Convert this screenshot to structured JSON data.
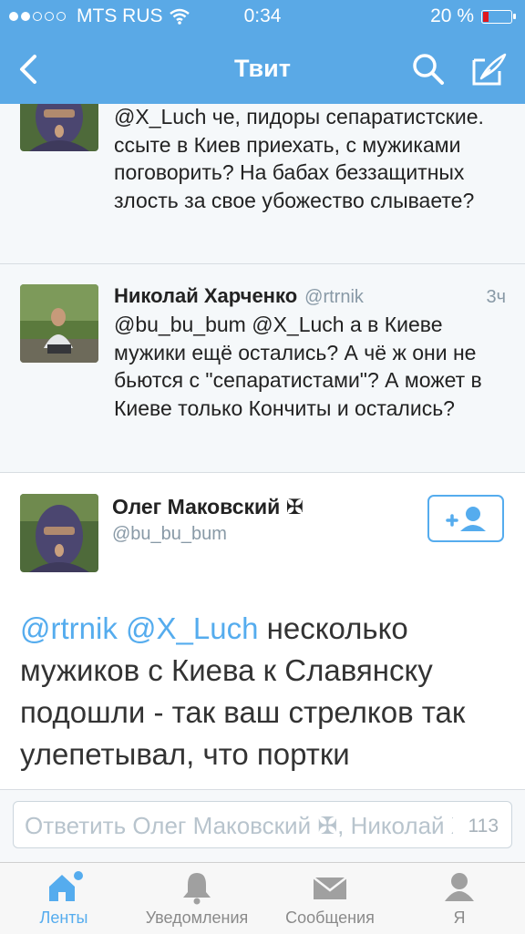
{
  "status_bar": {
    "carrier": "MTS RUS",
    "time": "0:34",
    "battery": "20 %",
    "battery_level": 0.2
  },
  "nav": {
    "title": "Твит",
    "back_icon": "chevron-left-icon",
    "search_icon": "search-icon",
    "compose_icon": "compose-icon"
  },
  "tweets": [
    {
      "text": "@X_Luch че, пидоры сепаратистские. ссыте в Киев приехать, с мужиками поговорить? На бабах беззащитных злость за свое убожество слываете?"
    },
    {
      "name": "Николай Харченко",
      "handle": "@rtrnik",
      "time": "3ч",
      "text": "@bu_bu_bum @X_Luch а в Киеве мужики ещё остались? А чё ж они не бьются с \"сепаратистами\"? А может в Киеве только Кончиты и остались?"
    }
  ],
  "main_tweet": {
    "name": "Олег Маковский ✠",
    "handle": "@bu_bu_bum",
    "mention1": "@rtrnik",
    "mention2": "@X_Luch",
    "text": "несколько мужиков с Киева к Славянску подошли - так ваш стрелков так улепетывал, что портки",
    "follow_icon": "follow-user-icon"
  },
  "reply": {
    "placeholder": "Ответить Олег Маковский ✠, Николай Харченко",
    "char_count": "113"
  },
  "tabs": [
    {
      "label": "Ленты",
      "icon": "home-icon",
      "active": true
    },
    {
      "label": "Уведомления",
      "icon": "bell-icon",
      "active": false
    },
    {
      "label": "Сообщения",
      "icon": "envelope-icon",
      "active": false
    },
    {
      "label": "Я",
      "icon": "person-icon",
      "active": false
    }
  ],
  "colors": {
    "accent": "#55acee",
    "header": "#5aa9e6"
  }
}
